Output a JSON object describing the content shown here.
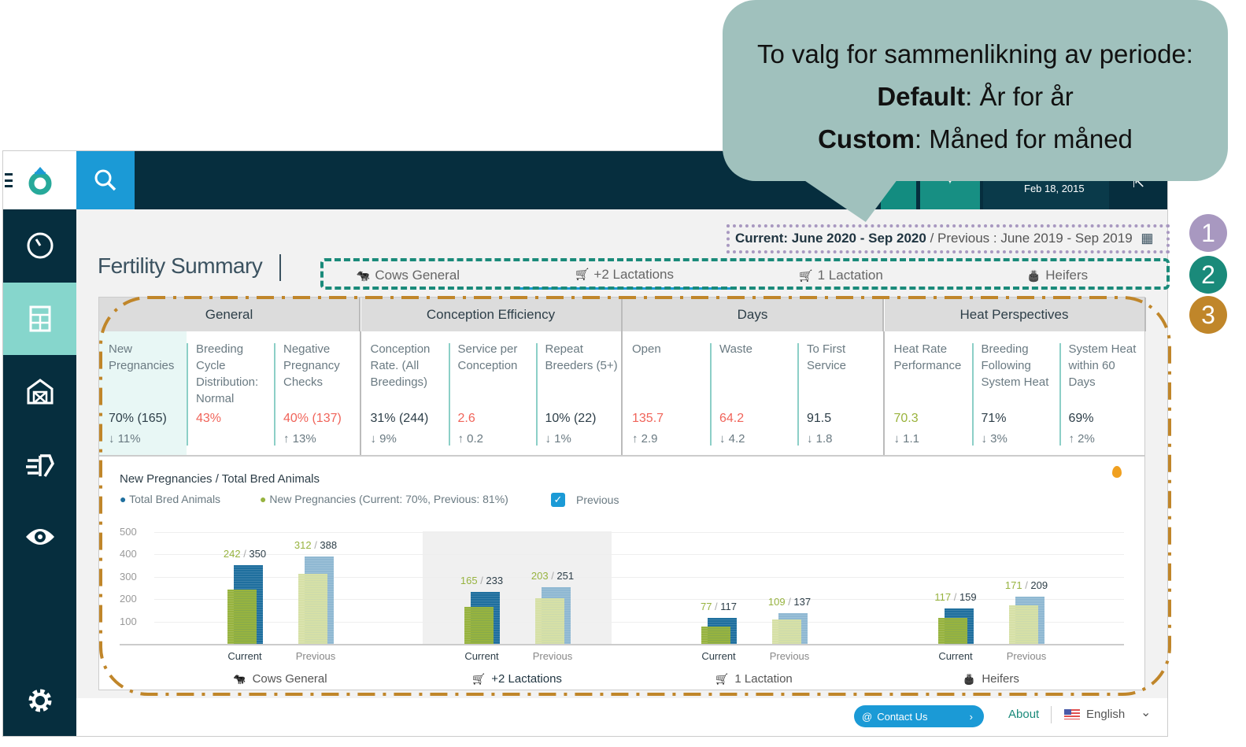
{
  "callout": {
    "line1": "To valg for sammenlikning av periode:",
    "line2_bold": "Default",
    "line2_rest": ": År for år",
    "line3_bold": "Custom",
    "line3_rest": ": Måned for måned"
  },
  "annotations": [
    "1",
    "2",
    "3"
  ],
  "header": {
    "date": "Feb 18, 2015"
  },
  "page": {
    "title": "Fertility Summary"
  },
  "period": {
    "current": "Current: June 2020 - Sep 2020",
    "separator": "/",
    "previous": "Previous : June 2019 - Sep 2019"
  },
  "tabs": [
    {
      "label": "Cows General",
      "icon": "cow-icon"
    },
    {
      "label": "+2 Lactations",
      "icon": "stroller-icon",
      "active": true
    },
    {
      "label": "1 Lactation",
      "icon": "stroller-icon"
    },
    {
      "label": "Heifers",
      "icon": "cake-icon"
    }
  ],
  "groups": [
    {
      "title": "General",
      "metrics": [
        {
          "label": "New Pregnancies",
          "value": "70% (165)",
          "change": "↓ 11%",
          "status": "normal",
          "selected": true
        },
        {
          "label": "Breeding Cycle Distribution: Normal",
          "value": "43%",
          "change": "",
          "status": "bad"
        },
        {
          "label": "Negative Pregnancy Checks",
          "value": "40% (137)",
          "change": "↑ 13%",
          "status": "bad"
        }
      ]
    },
    {
      "title": "Conception Efficiency",
      "metrics": [
        {
          "label": "Conception Rate. (All Breedings)",
          "value": "31% (244)",
          "change": "↓ 9%",
          "status": "normal"
        },
        {
          "label": "Service per Conception",
          "value": "2.6",
          "change": "↑ 0.2",
          "status": "bad"
        },
        {
          "label": "Repeat Breeders (5+)",
          "value": "10% (22)",
          "change": "↓ 1%",
          "status": "normal"
        }
      ]
    },
    {
      "title": "Days",
      "metrics": [
        {
          "label": "Open",
          "value": "135.7",
          "change": "↑ 2.9",
          "status": "bad"
        },
        {
          "label": "Waste",
          "value": "64.2",
          "change": "↓ 4.2",
          "status": "bad"
        },
        {
          "label": "To First Service",
          "value": "91.5",
          "change": "↓ 1.8",
          "status": "normal"
        }
      ]
    },
    {
      "title": "Heat Perspectives",
      "metrics": [
        {
          "label": "Heat Rate Performance",
          "value": "70.3",
          "change": "↓ 1.1",
          "status": "good"
        },
        {
          "label": "Breeding Following System Heat",
          "value": "71%",
          "change": "↓ 3%",
          "status": "normal"
        },
        {
          "label": "System Heat within 60 Days",
          "value": "69%",
          "change": "↑ 2%",
          "status": "normal"
        }
      ]
    }
  ],
  "colors": {
    "bad": "#f0645a",
    "good": "#9ab33c",
    "normal": "#2d3e48",
    "current_total": "#1f6f9e",
    "current_new": "#97b33f",
    "previous_total": "#8fb8d2",
    "previous_new": "#d6e0a6",
    "accent": "#1b9ad6"
  },
  "chart_data": {
    "type": "bar",
    "title": "New Pregnancies / Total Bred Animals",
    "legend": [
      "Total Bred Animals",
      "New Pregnancies (Current: 70%,  Previous: 81%)"
    ],
    "previous_checkbox": {
      "label": "Previous",
      "checked": true
    },
    "yticks": [
      500,
      400,
      300,
      200,
      100
    ],
    "ylim": [
      0,
      500
    ],
    "bar_labels": [
      "Current",
      "Previous"
    ],
    "categories": [
      {
        "name": "Cows General",
        "icon": "cow-icon",
        "current": {
          "new": 242,
          "total": 350
        },
        "previous": {
          "new": 312,
          "total": 388
        }
      },
      {
        "name": "+2 Lactations",
        "icon": "stroller-icon",
        "highlighted": true,
        "current": {
          "new": 165,
          "total": 233
        },
        "previous": {
          "new": 203,
          "total": 251
        }
      },
      {
        "name": "1 Lactation",
        "icon": "stroller-icon",
        "current": {
          "new": 77,
          "total": 117
        },
        "previous": {
          "new": 109,
          "total": 137
        }
      },
      {
        "name": "Heifers",
        "icon": "cake-icon",
        "current": {
          "new": 117,
          "total": 159
        },
        "previous": {
          "new": 171,
          "total": 209
        }
      }
    ]
  },
  "footer": {
    "contact": "Contact Us",
    "about": "About",
    "language": "English"
  }
}
